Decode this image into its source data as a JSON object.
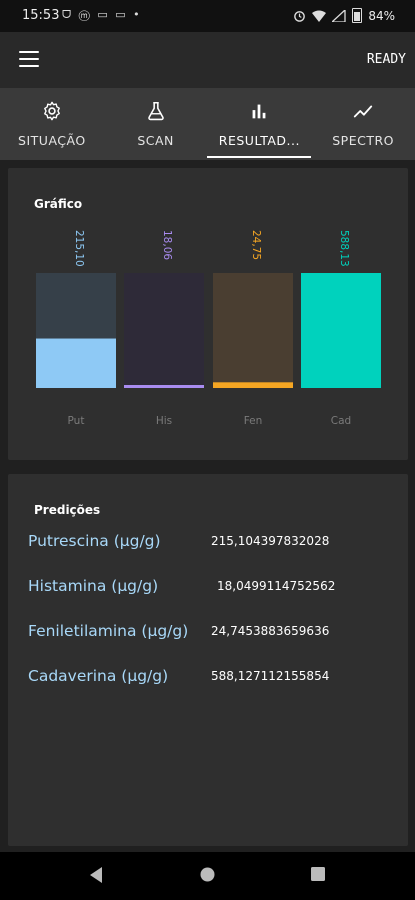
{
  "statusbar": {
    "time": "15:53",
    "left_icons": "ᗜ ⓜ ▭ ▭ •",
    "battery": "84%"
  },
  "appbar": {
    "status": "READY"
  },
  "tabs": [
    {
      "label": "SITUAÇÃO",
      "icon": "gear-icon"
    },
    {
      "label": "SCAN",
      "icon": "flask-icon"
    },
    {
      "label": "RESULTAD...",
      "icon": "bar-chart-icon"
    },
    {
      "label": "SPECTRO",
      "icon": "trend-line-icon"
    }
  ],
  "chart": {
    "title": "Gráfico"
  },
  "chart_data": {
    "type": "bar",
    "categories": [
      "Put",
      "His",
      "Fen",
      "Cad"
    ],
    "values": [
      215.1,
      18.06,
      24.75,
      588.13
    ],
    "value_labels": [
      "215,10",
      "18,06",
      "24,75",
      "588,13"
    ],
    "max_values": [
      500,
      500,
      500,
      588.13
    ],
    "ylim": [
      0,
      588.13
    ],
    "colors": [
      "#8ec9f5",
      "#a98cf0",
      "#f5a623",
      "#00d2bd"
    ],
    "bg_colors": [
      "#364049",
      "#2e2a38",
      "#4a3e31",
      "#2f4845"
    ],
    "label_colors": [
      "#8ec9f5",
      "#a98cf0",
      "#f5a623",
      "#00d2bd"
    ]
  },
  "predictions": {
    "title": "Predições",
    "items": [
      {
        "label": "Putrescina (μg/g)",
        "value": "215,104397832028"
      },
      {
        "label": "Histamina (μg/g)",
        "value": "18,0499114752562"
      },
      {
        "label": "Feniletilamina (μg/g)",
        "value": "24,7453883659636"
      },
      {
        "label": "Cadaverina (μg/g)",
        "value": "588,127112155854"
      }
    ]
  }
}
